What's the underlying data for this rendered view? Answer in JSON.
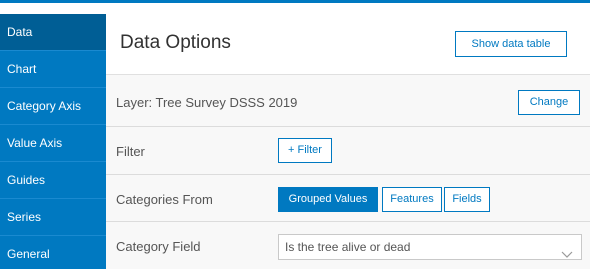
{
  "sidebar": {
    "items": [
      {
        "label": "Data",
        "active": true
      },
      {
        "label": "Chart",
        "active": false
      },
      {
        "label": "Category Axis",
        "active": false
      },
      {
        "label": "Value Axis",
        "active": false
      },
      {
        "label": "Guides",
        "active": false
      },
      {
        "label": "Series",
        "active": false
      },
      {
        "label": "General",
        "active": false
      }
    ]
  },
  "panel": {
    "title": "Data Options",
    "show_table_label": "Show data table",
    "layer_label": "Layer: Tree Survey DSSS 2019",
    "change_label": "Change",
    "filter": {
      "label": "Filter",
      "button_label": "+ Filter"
    },
    "categories_from": {
      "label": "Categories From",
      "options": [
        {
          "label": "Grouped Values",
          "selected": true
        },
        {
          "label": "Features",
          "selected": false
        },
        {
          "label": "Fields",
          "selected": false
        }
      ]
    },
    "category_field": {
      "label": "Category Field",
      "value": "Is the tree alive or dead",
      "icon": "chevron-down-icon"
    }
  },
  "colors": {
    "accent": "#0079c1",
    "active_nav": "#005e95"
  }
}
